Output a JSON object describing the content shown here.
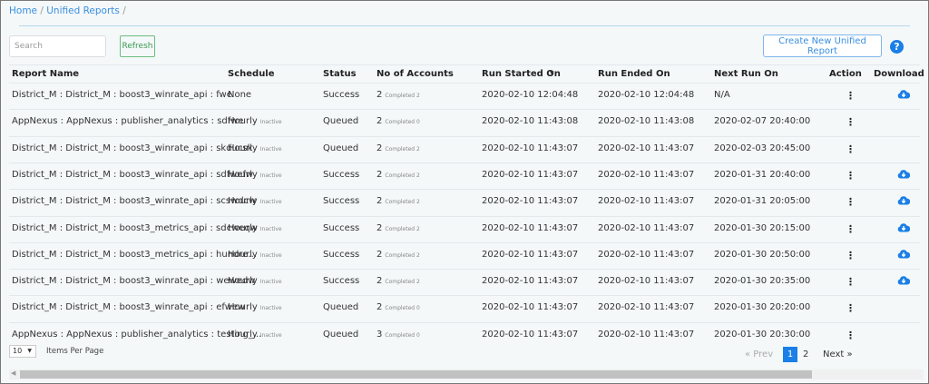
{
  "breadcrumb": {
    "home": "Home",
    "section": "Unified Reports",
    "sep": "/"
  },
  "toolbar": {
    "search_placeholder": "Search",
    "refresh_label": "Refresh",
    "create_label": "Create New Unified Report",
    "help_label": "?"
  },
  "columns": [
    "Report Name",
    "Schedule",
    "Status",
    "No of Accounts",
    "Run Started On",
    "Run Ended On",
    "Next Run On",
    "Action",
    "Download"
  ],
  "sort_indicator": "▾",
  "rows": [
    {
      "name": "District_M : District_M : boost3_winrate_api : fwe",
      "schedule": "None",
      "schedule_note": "",
      "status": "Success",
      "accounts": "2",
      "completed": "Completed 2",
      "started": "2020-02-10 12:04:48",
      "ended": "2020-02-10 12:04:48",
      "next": "N/A",
      "download": true
    },
    {
      "name": "AppNexus : AppNexus : publisher_analytics : sdfwe",
      "schedule": "Hourly",
      "schedule_note": "Inactive",
      "status": "Queued",
      "accounts": "2",
      "completed": "Completed 0",
      "started": "2020-02-10 11:43:08",
      "ended": "2020-02-10 11:43:08",
      "next": "2020-02-07 20:40:00",
      "download": false
    },
    {
      "name": "District_M : District_M : boost3_winrate_api : skducsk",
      "schedule": "Hourly",
      "schedule_note": "Inactive",
      "status": "Queued",
      "accounts": "2",
      "completed": "Completed 2",
      "started": "2020-02-10 11:43:07",
      "ended": "2020-02-10 11:43:07",
      "next": "2020-02-03 20:45:00",
      "download": false
    },
    {
      "name": "District_M : District_M : boost3_winrate_api : sdfwefw",
      "schedule": "Hourly",
      "schedule_note": "Inactive",
      "status": "Success",
      "accounts": "2",
      "completed": "Completed 2",
      "started": "2020-02-10 11:43:07",
      "ended": "2020-02-10 11:43:07",
      "next": "2020-01-31 20:40:00",
      "download": true
    },
    {
      "name": "District_M : District_M : boost3_winrate_api : scswdcw",
      "schedule": "Hourly",
      "schedule_note": "Inactive",
      "status": "Success",
      "accounts": "2",
      "completed": "Completed 2",
      "started": "2020-02-10 11:43:07",
      "ended": "2020-02-10 11:43:07",
      "next": "2020-01-31 20:05:00",
      "download": true
    },
    {
      "name": "District_M : District_M : boost3_metrics_api : sdcweqw",
      "schedule": "Hourly",
      "schedule_note": "Inactive",
      "status": "Success",
      "accounts": "2",
      "completed": "Completed 2",
      "started": "2020-02-10 11:43:07",
      "ended": "2020-02-10 11:43:07",
      "next": "2020-01-30 20:15:00",
      "download": true
    },
    {
      "name": "District_M : District_M : boost3_metrics_api : hundre...",
      "schedule": "Hourly",
      "schedule_note": "Inactive",
      "status": "Success",
      "accounts": "2",
      "completed": "Completed 2",
      "started": "2020-02-10 11:43:07",
      "ended": "2020-02-10 11:43:07",
      "next": "2020-01-30 20:50:00",
      "download": true
    },
    {
      "name": "District_M : District_M : boost3_winrate_api : wewedw",
      "schedule": "Hourly",
      "schedule_note": "Inactive",
      "status": "Success",
      "accounts": "2",
      "completed": "Completed 2",
      "started": "2020-02-10 11:43:07",
      "ended": "2020-02-10 11:43:07",
      "next": "2020-01-30 20:35:00",
      "download": true
    },
    {
      "name": "District_M : District_M : boost3_winrate_api : efwew",
      "schedule": "Hourly",
      "schedule_note": "Inactive",
      "status": "Queued",
      "accounts": "2",
      "completed": "Completed 0",
      "started": "2020-02-10 11:43:07",
      "ended": "2020-02-10 11:43:07",
      "next": "2020-01-30 20:20:00",
      "download": false
    },
    {
      "name": "AppNexus : AppNexus : publisher_analytics : testing_...",
      "schedule": "Hourly",
      "schedule_note": "Inactive",
      "status": "Queued",
      "accounts": "3",
      "completed": "Completed 0",
      "started": "2020-02-10 11:43:07",
      "ended": "2020-02-10 11:43:07",
      "next": "2020-01-30 20:30:00",
      "download": false
    }
  ],
  "footer": {
    "per_page": "10",
    "per_page_label": "Items Per Page",
    "prev": "« Prev",
    "pages": [
      "1",
      "2"
    ],
    "current_page": "1",
    "next": "Next »"
  },
  "colors": {
    "accent": "#1a7fe6",
    "refresh": "#3a9a52"
  }
}
